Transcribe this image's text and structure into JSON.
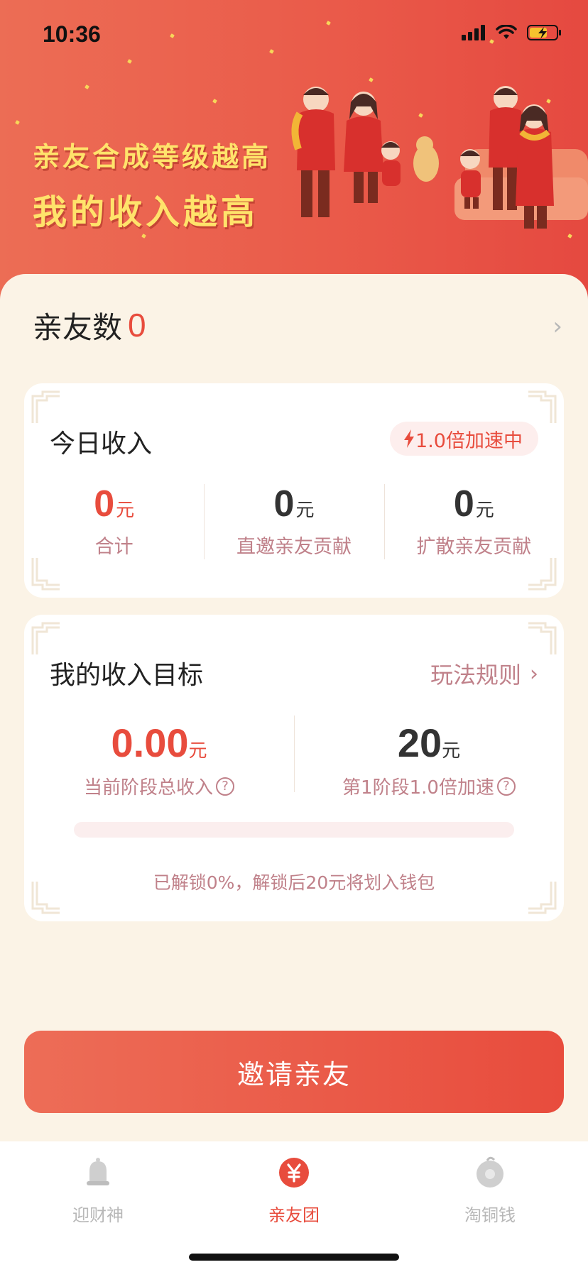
{
  "status_bar": {
    "time": "10:36"
  },
  "banner": {
    "slogan_line1": "亲友合成等级越高",
    "slogan_line2": "我的收入越高"
  },
  "friends": {
    "label": "亲友数",
    "count": "0"
  },
  "today_income": {
    "title": "今日收入",
    "speed_badge": "1.0倍加速中",
    "stats": [
      {
        "value": "0",
        "unit": "元",
        "label": "合计"
      },
      {
        "value": "0",
        "unit": "元",
        "label": "直邀亲友贡献"
      },
      {
        "value": "0",
        "unit": "元",
        "label": "扩散亲友贡献"
      }
    ]
  },
  "income_goal": {
    "title": "我的收入目标",
    "rules_link": "玩法规则",
    "current": {
      "value": "0.00",
      "unit": "元",
      "label": "当前阶段总收入"
    },
    "target": {
      "value": "20",
      "unit": "元",
      "label": "第1阶段1.0倍加速"
    },
    "progress_percent": 0,
    "unlock_text": "已解锁0%，解锁后20元将划入钱包"
  },
  "invite_button": "邀请亲友",
  "tabs": [
    {
      "label": "迎财神",
      "icon": "god-of-wealth-icon",
      "active": false
    },
    {
      "label": "亲友团",
      "icon": "yuan-coin-icon",
      "active": true
    },
    {
      "label": "淘铜钱",
      "icon": "copper-coin-icon",
      "active": false
    }
  ],
  "colors": {
    "accent": "#e84c3d",
    "banner_start": "#ec6d55",
    "banner_end": "#e54940",
    "slogan": "#ffe36b",
    "muted_pink": "#c0818a",
    "background": "#fbf3e6"
  }
}
